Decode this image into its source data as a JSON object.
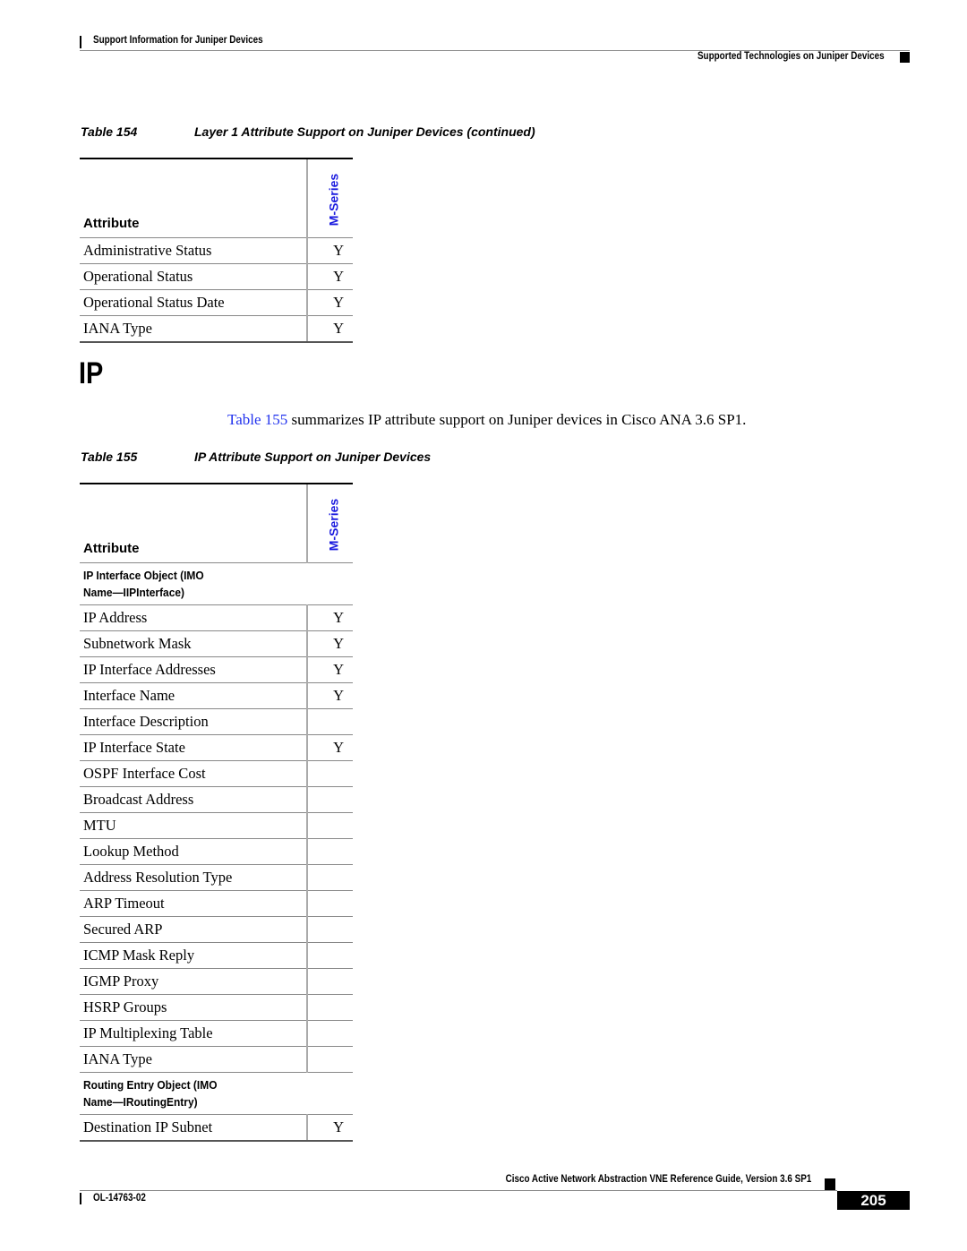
{
  "header": {
    "left": "Support Information for Juniper Devices",
    "right": "Supported Technologies on Juniper Devices"
  },
  "table154": {
    "number": "Table 154",
    "title": "Layer 1 Attribute Support on Juniper Devices (continued)",
    "columns": [
      "Attribute",
      "M-Series"
    ],
    "rows": [
      {
        "attribute": "Administrative Status",
        "m_series": "Y"
      },
      {
        "attribute": "Operational Status",
        "m_series": "Y"
      },
      {
        "attribute": "Operational Status Date",
        "m_series": "Y"
      },
      {
        "attribute": "IANA Type",
        "m_series": "Y"
      }
    ]
  },
  "section": {
    "title": "IP",
    "paragraph_link": "Table 155",
    "paragraph_rest": " summarizes IP attribute support on Juniper devices in Cisco ANA 3.6 SP1."
  },
  "table155": {
    "number": "Table 155",
    "title": "IP Attribute Support on Juniper Devices",
    "columns": [
      "Attribute",
      "M-Series"
    ],
    "groups": [
      {
        "label_line1": "IP Interface Object (IMO",
        "label_line2": "Name—IIPInterface)",
        "rows": [
          {
            "attribute": "IP Address",
            "m_series": "Y"
          },
          {
            "attribute": "Subnetwork Mask",
            "m_series": "Y"
          },
          {
            "attribute": "IP Interface Addresses",
            "m_series": "Y"
          },
          {
            "attribute": "Interface Name",
            "m_series": "Y"
          },
          {
            "attribute": "Interface Description",
            "m_series": ""
          },
          {
            "attribute": "IP Interface State",
            "m_series": "Y"
          },
          {
            "attribute": "OSPF Interface Cost",
            "m_series": ""
          },
          {
            "attribute": "Broadcast Address",
            "m_series": ""
          },
          {
            "attribute": "MTU",
            "m_series": ""
          },
          {
            "attribute": "Lookup Method",
            "m_series": ""
          },
          {
            "attribute": "Address Resolution Type",
            "m_series": ""
          },
          {
            "attribute": "ARP Timeout",
            "m_series": ""
          },
          {
            "attribute": "Secured ARP",
            "m_series": ""
          },
          {
            "attribute": "ICMP Mask Reply",
            "m_series": ""
          },
          {
            "attribute": "IGMP Proxy",
            "m_series": ""
          },
          {
            "attribute": "HSRP Groups",
            "m_series": ""
          },
          {
            "attribute": "IP Multiplexing Table",
            "m_series": ""
          },
          {
            "attribute": "IANA Type",
            "m_series": ""
          }
        ]
      },
      {
        "label_line1": "Routing Entry Object (IMO",
        "label_line2": "Name—IRoutingEntry)",
        "rows": [
          {
            "attribute": "Destination IP Subnet",
            "m_series": "Y"
          }
        ]
      }
    ]
  },
  "footer": {
    "title": "Cisco Active Network Abstraction VNE Reference Guide, Version 3.6 SP1",
    "doc_number": "OL-14763-02",
    "page_number": "205"
  },
  "colors": {
    "link": "#2233ee",
    "series_header": "#1a1adf"
  }
}
